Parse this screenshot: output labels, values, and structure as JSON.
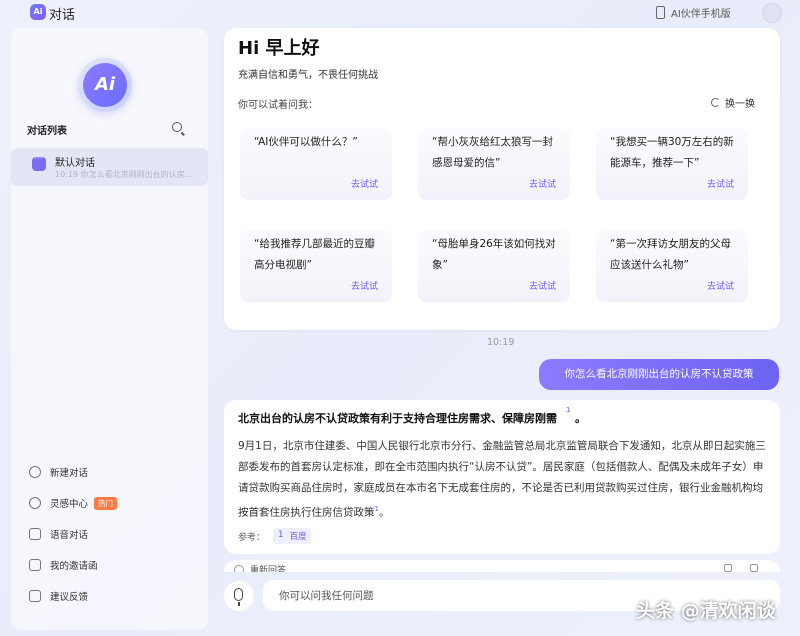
{
  "header": {
    "logo_text": "Ai",
    "title": "对话",
    "phone_link": "AI伙伴手机版"
  },
  "sidebar": {
    "logo_text": "Ai",
    "list_title": "对话列表",
    "conversation": {
      "name": "默认对话",
      "time": "10:19",
      "preview": "你怎么看北京刚刚出台的认房..."
    },
    "nav": {
      "new_chat": "新建对话",
      "inspiration": "灵感中心",
      "hot_badge": "热门",
      "voice_chat": "语音对话",
      "invitations": "我的邀请函",
      "feedback": "建议反馈"
    }
  },
  "greeting": {
    "title": "Hi 早上好",
    "subtitle": "充满自信和勇气，不畏任何挑战",
    "try_label": "你可以试着问我：",
    "refresh_label": "换一换",
    "try_button": "去试试",
    "suggestions": [
      "“AI伙伴可以做什么？”",
      "“帮小灰灰给红太狼写一封感恩母爱的信”",
      "“我想买一辆30万左右的新能源车，推荐一下”",
      "“给我推荐几部最近的豆瓣高分电视剧”",
      "“母胎单身26年该如何找对象”",
      "“第一次拜访女朋友的父母应该送什么礼物”"
    ]
  },
  "chat": {
    "timestamp": "10:19",
    "user_message": "你怎么看北京刚刚出台的认房不认贷政策",
    "answer": {
      "title": "北京出台的认房不认贷政策有利于支持合理住房需求、保障房刚需",
      "title_ref": "1",
      "title_end": "。",
      "body": "9月1日，北京市住建委、中国人民银行北京市分行、金融监管总局北京监管局联合下发通知，北京从即日起实施三部委发布的首套房认定标准，即在全市范围内执行“认房不认贷”。居民家庭（包括借款人、配偶及未成年子女）申请贷款购买商品住房时，家庭成员在本市名下无成套住房的，不论是否已利用贷款购买过住房，银行业金融机构均按首套住房执行住房信贷政策",
      "body_ref": "1",
      "body_end": "。",
      "refs_label": "参考：",
      "ref_number": "1",
      "ref_name": "百度"
    },
    "next_label": "重新回答"
  },
  "input": {
    "placeholder": "你可以问我任何问题"
  },
  "watermark": "头条 @清欢闲谈"
}
